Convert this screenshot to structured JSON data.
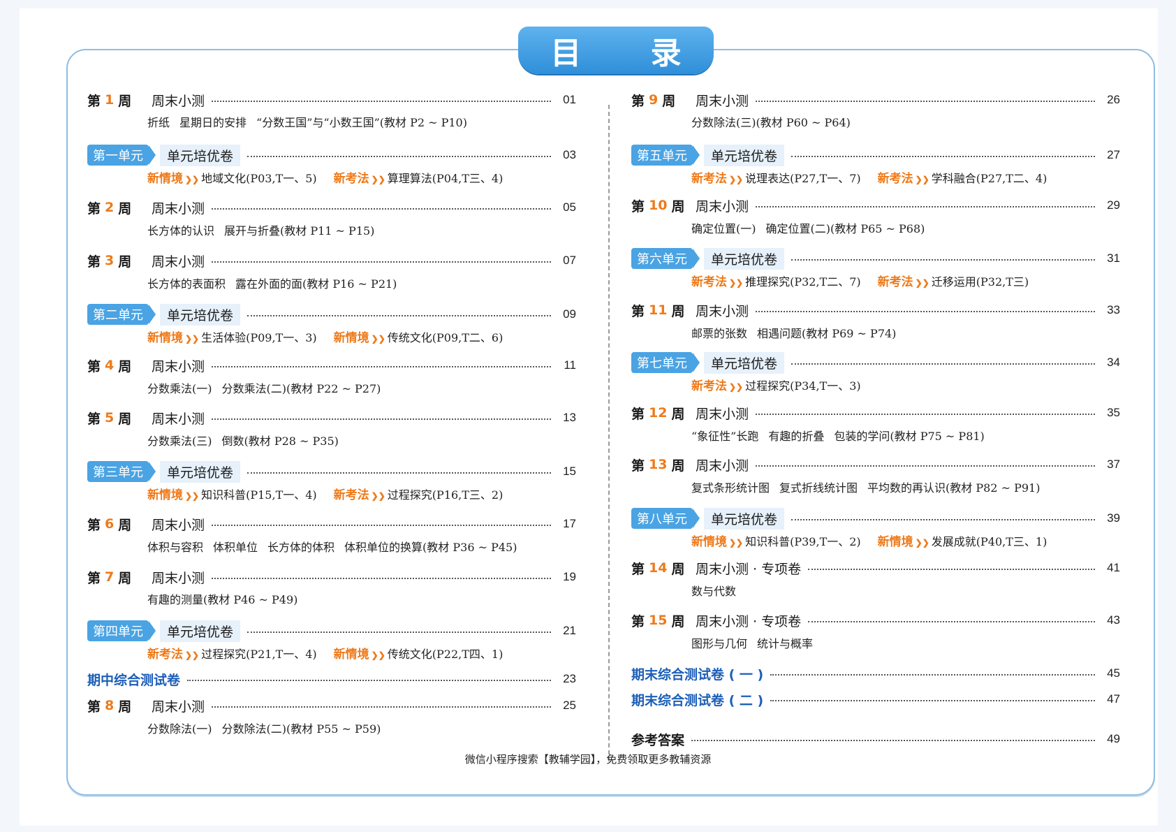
{
  "title": "目 录",
  "footer": "微信小程序搜索【教辅学园】，免费领取更多教辅资源",
  "left": {
    "w1": {
      "pre": "第",
      "num": "1",
      "post": "周",
      "title": "周末小测",
      "page": "01",
      "sub": [
        "折纸",
        "星期日的安排",
        "“分数王国”与“小数王国”(教材 P2 ~ P10)"
      ]
    },
    "u1": {
      "badge": "第一单元",
      "title": "单元培优卷",
      "page": "03",
      "t1": "新情境",
      "d1": "地域文化(P03,T一、5)",
      "t2": "新考法",
      "d2": "算理算法(P04,T三、4)"
    },
    "w2": {
      "pre": "第",
      "num": "2",
      "post": "周",
      "title": "周末小测",
      "page": "05",
      "sub": [
        "长方体的认识",
        "展开与折叠(教材 P11 ~ P15)"
      ]
    },
    "w3": {
      "pre": "第",
      "num": "3",
      "post": "周",
      "title": "周末小测",
      "page": "07",
      "sub": [
        "长方体的表面积",
        "露在外面的面(教材 P16 ~ P21)"
      ]
    },
    "u2": {
      "badge": "第二单元",
      "title": "单元培优卷",
      "page": "09",
      "t1": "新情境",
      "d1": "生活体验(P09,T一、3)",
      "t2": "新情境",
      "d2": "传统文化(P09,T二、6)"
    },
    "w4": {
      "pre": "第",
      "num": "4",
      "post": "周",
      "title": "周末小测",
      "page": "11",
      "sub": [
        "分数乘法(一)",
        "分数乘法(二)(教材 P22 ~ P27)"
      ]
    },
    "w5": {
      "pre": "第",
      "num": "5",
      "post": "周",
      "title": "周末小测",
      "page": "13",
      "sub": [
        "分数乘法(三)",
        "倒数(教材 P28 ~ P35)"
      ]
    },
    "u3": {
      "badge": "第三单元",
      "title": "单元培优卷",
      "page": "15",
      "t1": "新情境",
      "d1": "知识科普(P15,T一、4)",
      "t2": "新考法",
      "d2": "过程探究(P16,T三、2)"
    },
    "w6": {
      "pre": "第",
      "num": "6",
      "post": "周",
      "title": "周末小测",
      "page": "17",
      "sub": [
        "体积与容积",
        "体积单位",
        "长方体的体积",
        "体积单位的换算(教材 P36 ~ P45)"
      ]
    },
    "w7": {
      "pre": "第",
      "num": "7",
      "post": "周",
      "title": "周末小测",
      "page": "19",
      "sub": [
        "有趣的测量(教材 P46 ~ P49)"
      ]
    },
    "u4": {
      "badge": "第四单元",
      "title": "单元培优卷",
      "page": "21",
      "t1": "新考法",
      "d1": "过程探究(P21,T一、4)",
      "t2": "新情境",
      "d2": "传统文化(P22,T四、1)"
    },
    "mid": {
      "title": "期中综合测试卷",
      "page": "23"
    },
    "w8": {
      "pre": "第",
      "num": "8",
      "post": "周",
      "title": "周末小测",
      "page": "25",
      "sub": [
        "分数除法(一)",
        "分数除法(二)(教材 P55 ~ P59)"
      ]
    }
  },
  "right": {
    "w9": {
      "pre": "第",
      "num": "9",
      "post": "周",
      "title": "周末小测",
      "page": "26",
      "sub": [
        "分数除法(三)(教材 P60 ~ P64)"
      ]
    },
    "u5": {
      "badge": "第五单元",
      "title": "单元培优卷",
      "page": "27",
      "t1": "新考法",
      "d1": "说理表达(P27,T一、7)",
      "t2": "新考法",
      "d2": "学科融合(P27,T二、4)"
    },
    "w10": {
      "pre": "第",
      "num": "10",
      "post": "周",
      "title": "周末小测",
      "page": "29",
      "sub": [
        "确定位置(一)",
        "确定位置(二)(教材 P65 ~ P68)"
      ]
    },
    "u6": {
      "badge": "第六单元",
      "title": "单元培优卷",
      "page": "31",
      "t1": "新考法",
      "d1": "推理探究(P32,T二、7)",
      "t2": "新考法",
      "d2": "迁移运用(P32,T三)"
    },
    "w11": {
      "pre": "第",
      "num": "11",
      "post": "周",
      "title": "周末小测",
      "page": "33",
      "sub": [
        "邮票的张数",
        "相遇问题(教材 P69 ~ P74)"
      ]
    },
    "u7": {
      "badge": "第七单元",
      "title": "单元培优卷",
      "page": "34",
      "t1": "新考法",
      "d1": "过程探究(P34,T一、3)"
    },
    "w12": {
      "pre": "第",
      "num": "12",
      "post": "周",
      "title": "周末小测",
      "page": "35",
      "sub": [
        "“象征性”长跑",
        "有趣的折叠",
        "包装的学问(教材 P75 ~ P81)"
      ]
    },
    "w13": {
      "pre": "第",
      "num": "13",
      "post": "周",
      "title": "周末小测",
      "page": "37",
      "sub": [
        "复式条形统计图",
        "复式折线统计图",
        "平均数的再认识(教材 P82 ~ P91)"
      ]
    },
    "u8": {
      "badge": "第八单元",
      "title": "单元培优卷",
      "page": "39",
      "t1": "新情境",
      "d1": "知识科普(P39,T一、2)",
      "t2": "新情境",
      "d2": "发展成就(P40,T三、1)"
    },
    "w14": {
      "pre": "第",
      "num": "14",
      "post": "周",
      "title": "周末小测 · 专项卷",
      "page": "41",
      "sub": [
        "数与代数"
      ]
    },
    "w15": {
      "pre": "第",
      "num": "15",
      "post": "周",
      "title": "周末小测 · 专项卷",
      "page": "43",
      "sub": [
        "图形与几何",
        "统计与概率"
      ]
    },
    "final1": {
      "title": "期末综合测试卷 ( 一 )",
      "page": "45"
    },
    "final2": {
      "title": "期末综合测试卷 ( 二 )",
      "page": "47"
    },
    "answers": {
      "title": "参考答案",
      "page": "49"
    }
  }
}
